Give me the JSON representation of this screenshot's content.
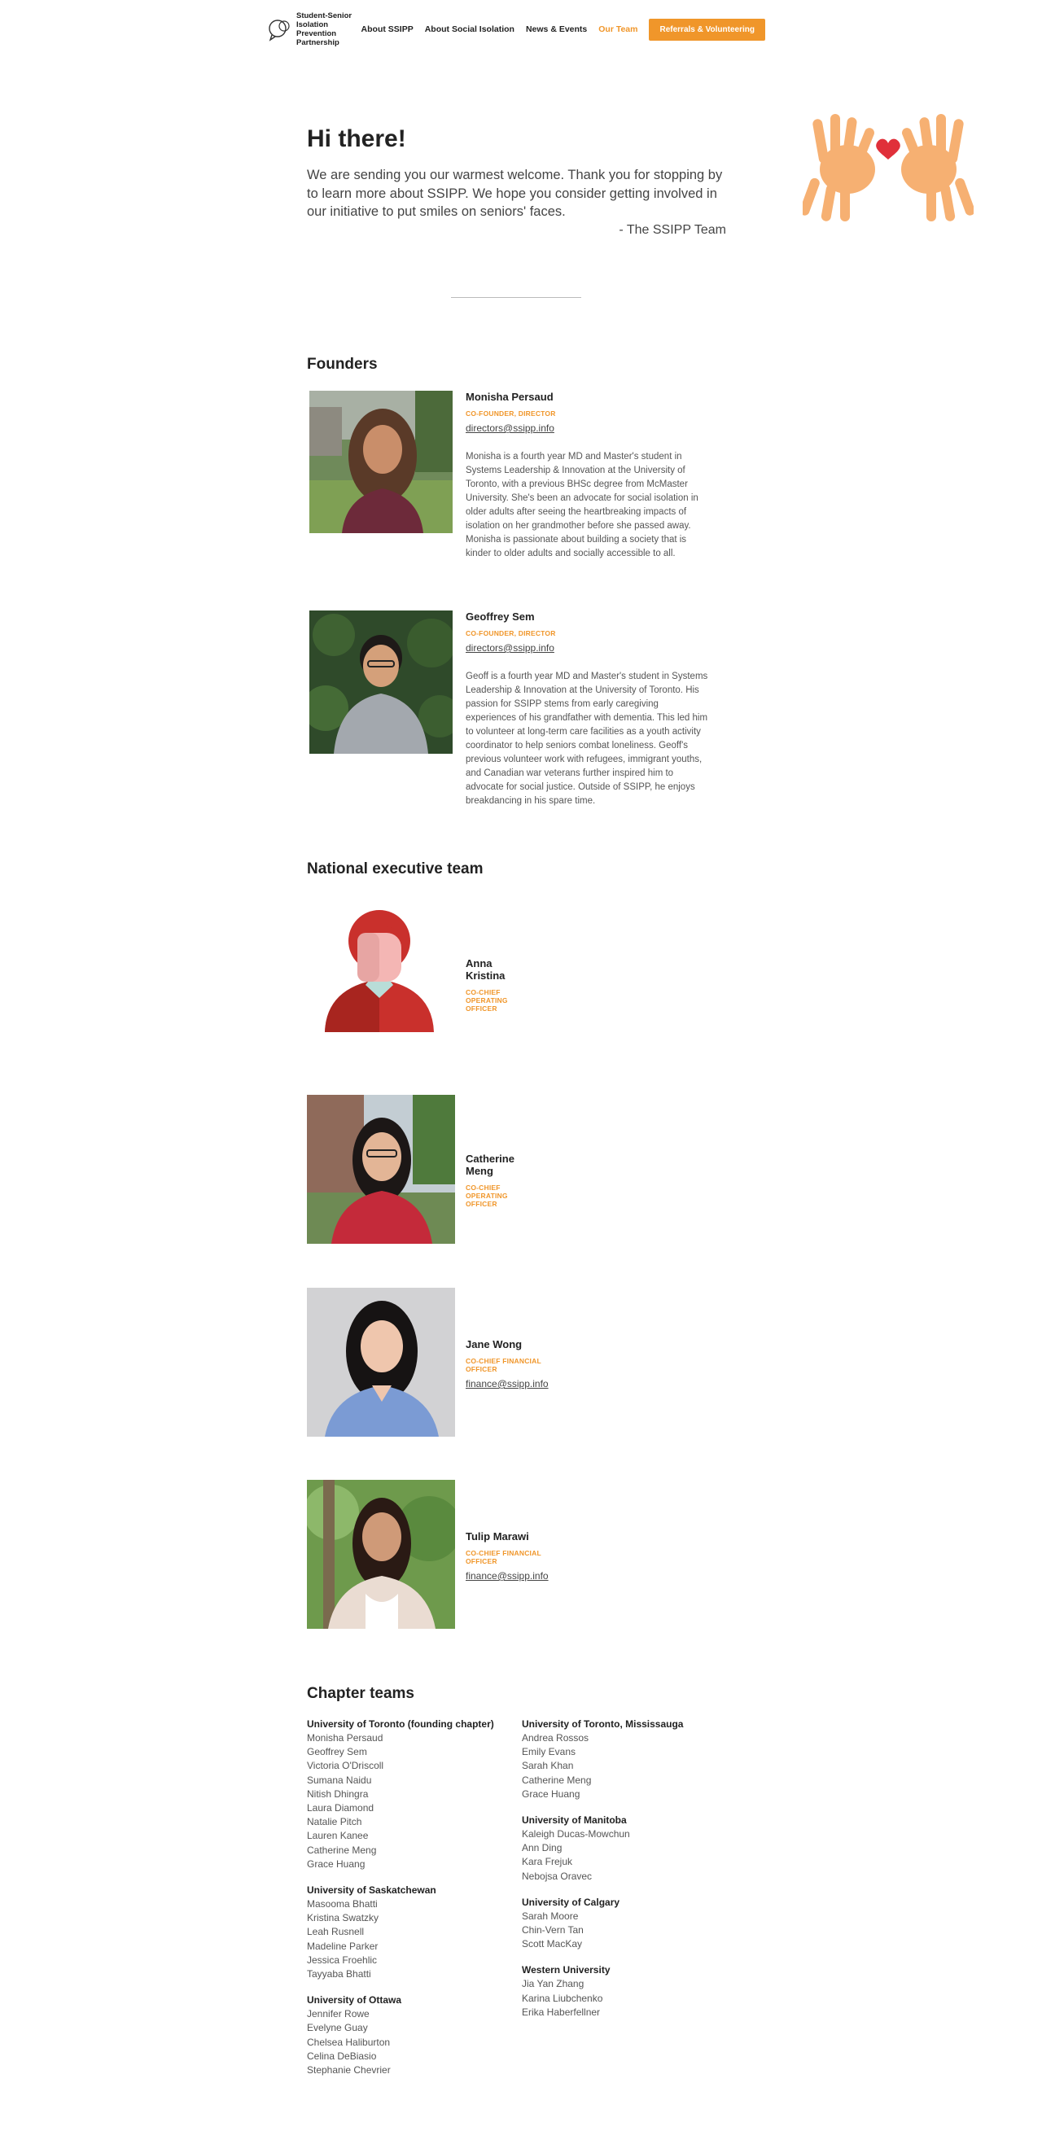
{
  "header": {
    "logo_lines": [
      "Student-Senior",
      "Isolation Prevention",
      "Partnership"
    ],
    "nav": [
      "About SSIPP",
      "About Social Isolation",
      "News & Events",
      "Our Team"
    ],
    "active": "Our Team",
    "cta": "Referrals & Volunteering"
  },
  "hero": {
    "title": "Hi there!",
    "text": "We are sending you our warmest welcome. Thank you for stopping by to learn more about SSIPP. We hope you consider getting involved in our initiative to put smiles on seniors' faces.",
    "signature": "- The SSIPP Team"
  },
  "founders": {
    "heading": "Founders",
    "people": [
      {
        "name": "Monisha Persaud",
        "role": "CO-FOUNDER, DIRECTOR",
        "email": "directors@ssipp.info",
        "bio": "Monisha is a fourth year MD and Master's student in Systems Leadership & Innovation at the University of Toronto, with a previous BHSc degree from McMaster University. She's been an advocate for social isolation in older adults after seeing the heartbreaking impacts of isolation on her grandmother before she passed away. Monisha is passionate about building a society that is kinder to older adults and socially accessible to all."
      },
      {
        "name": "Geoffrey Sem",
        "role": "CO-FOUNDER, DIRECTOR",
        "email": "directors@ssipp.info",
        "bio": "Geoff is a fourth year MD and Master's student in Systems Leadership & Innovation at the University of Toronto. His passion for SSIPP stems from early caregiving experiences of his grandfather with dementia. This led him to volunteer at long-term care facilities as a youth activity coordinator to help seniors combat loneliness. Geoff's previous volunteer work with refugees, immigrant youths, and Canadian war veterans further inspired him to advocate for social justice. Outside of SSIPP, he enjoys breakdancing in his spare time."
      }
    ]
  },
  "executive": {
    "heading": "National executive team",
    "people": [
      {
        "name": "Anna Kristina",
        "role": "CO-CHIEF OPERATING OFFICER",
        "email": ""
      },
      {
        "name": "Catherine Meng",
        "role": "CO-CHIEF OPERATING OFFICER",
        "email": ""
      },
      {
        "name": "Jane Wong",
        "role": "CO-CHIEF FINANCIAL OFFICER",
        "email": "finance@ssipp.info"
      },
      {
        "name": "Tulip Marawi",
        "role": "CO-CHIEF FINANCIAL OFFICER",
        "email": "finance@ssipp.info"
      }
    ]
  },
  "chapters": {
    "heading": "Chapter teams",
    "left": [
      {
        "name": "University of Toronto (founding chapter)",
        "members": [
          "Monisha Persaud",
          "Geoffrey Sem",
          "Victoria O'Driscoll",
          "Sumana Naidu",
          "Nitish Dhingra",
          "Laura Diamond",
          "Natalie Pitch",
          "Lauren Kanee",
          "Catherine Meng",
          "Grace Huang"
        ]
      },
      {
        "name": "University of Saskatchewan",
        "members": [
          "Masooma Bhatti",
          "Kristina Swatzky",
          "Leah Rusnell",
          "Madeline Parker",
          "Jessica Froehlic",
          "Tayyaba Bhatti"
        ]
      },
      {
        "name": "University of Ottawa",
        "members": [
          "Jennifer Rowe",
          "Evelyne Guay",
          "Chelsea Haliburton",
          "Celina DeBiasio",
          "Stephanie Chevrier"
        ]
      }
    ],
    "right": [
      {
        "name": "University of Toronto, Mississauga",
        "members": [
          "Andrea Rossos",
          "Emily Evans",
          "Sarah Khan",
          "Catherine Meng",
          "Grace Huang"
        ]
      },
      {
        "name": "University of Manitoba",
        "members": [
          "Kaleigh Ducas-Mowchun",
          "Ann Ding",
          "Kara Frejuk",
          "Nebojsa Oravec"
        ]
      },
      {
        "name": "University of Calgary",
        "members": [
          "Sarah Moore",
          "Chin-Vern Tan",
          "Scott MacKay"
        ]
      },
      {
        "name": "Western University",
        "members": [
          "Jia Yan Zhang",
          "Karina Liubchenko",
          "Erika Haberfellner"
        ]
      }
    ]
  },
  "colors": {
    "accent": "#f0962a",
    "text": "#222222"
  }
}
